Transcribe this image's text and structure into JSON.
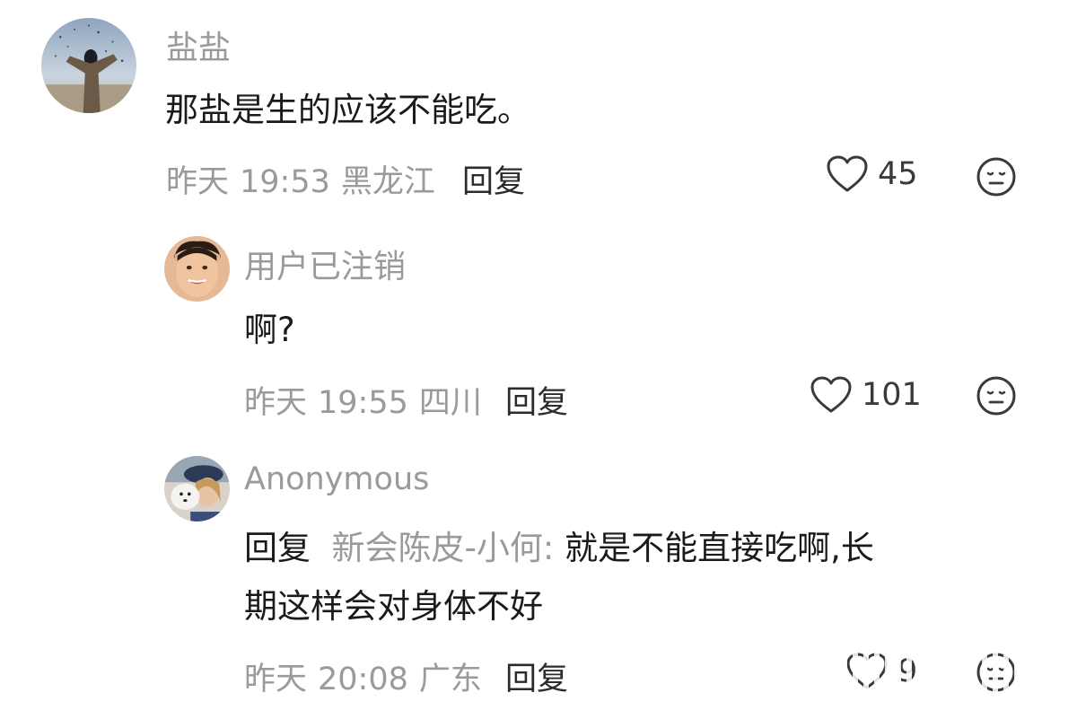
{
  "comments": [
    {
      "username": "盐盐",
      "text": "那盐是生的应该不能吃。",
      "date": "昨天",
      "time": "19:53",
      "location": "黑龙江",
      "reply_label": "回复",
      "likes": "45",
      "more_icon": "face-neutral-icon",
      "like_icon": "heart-outline-icon"
    },
    {
      "username": "用户已注销",
      "text": "啊?",
      "date": "昨天",
      "time": "19:55",
      "location": "四川",
      "reply_label": "回复",
      "likes": "101",
      "more_icon": "face-neutral-icon",
      "like_icon": "heart-outline-icon"
    },
    {
      "username": "Anonymous",
      "reply_prefix": "回复",
      "reply_target": "新会陈皮-小何:",
      "text_line1": "就是不能直接吃啊,长",
      "text_line2": "期这样会对身体不好",
      "date": "昨天",
      "time": "20:08",
      "location": "广东",
      "reply_label": "回复",
      "likes": "9",
      "more_icon": "face-neutral-icon",
      "like_icon": "heart-outline-icon"
    }
  ],
  "colors": {
    "username": "#9a9a9a",
    "text": "#1a1a1a",
    "meta": "#9a9a9a"
  }
}
